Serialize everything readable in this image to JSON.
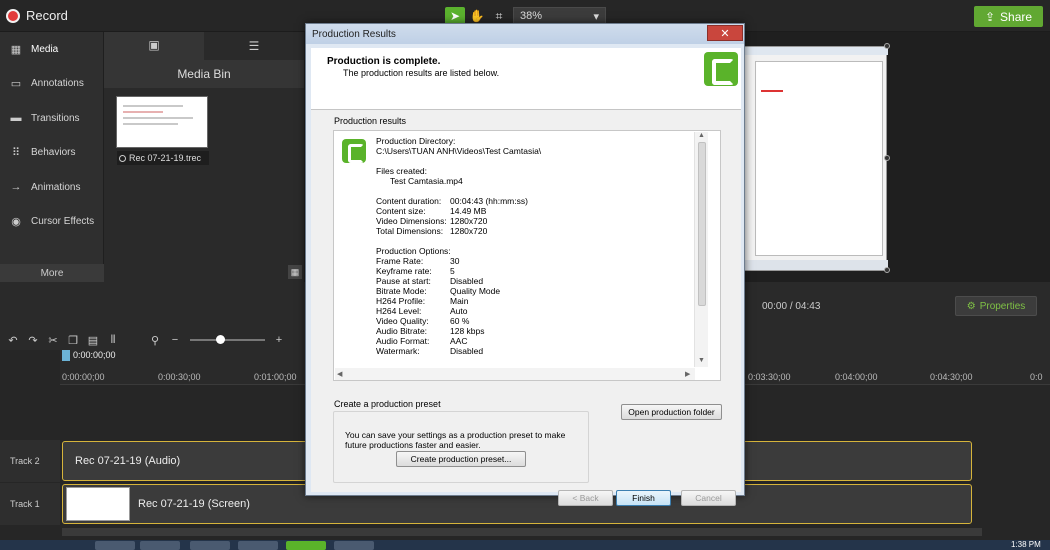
{
  "topbar": {
    "record_label": "Record",
    "zoom_value": "38%",
    "share_label": "Share",
    "colors": {
      "share": "#61a832",
      "record_dot": "#e23b3b"
    }
  },
  "sidebar": {
    "items": [
      {
        "label": "Media",
        "icon": "film-icon"
      },
      {
        "label": "Annotations",
        "icon": "annotation-icon"
      },
      {
        "label": "Transitions",
        "icon": "transition-icon"
      },
      {
        "label": "Behaviors",
        "icon": "behavior-icon"
      },
      {
        "label": "Animations",
        "icon": "animation-icon"
      },
      {
        "label": "Cursor Effects",
        "icon": "cursor-icon"
      }
    ],
    "more_label": "More",
    "add_label": "+"
  },
  "media_bin": {
    "title": "Media Bin",
    "clip_label": "Rec 07-21-19.trec"
  },
  "playback": {
    "current_time": "00:00",
    "separator": "/",
    "total_time": "04:43",
    "properties_label": "Properties"
  },
  "timeline": {
    "playhead_time": "0:00:00;00",
    "ticks": [
      "0:00:00;00",
      "0:00:30;00",
      "0:01:00;00",
      "0:03:30;00",
      "0:04:00;00",
      "0:04:30;00",
      "0:0"
    ],
    "tracks": [
      {
        "label": "Track 2",
        "clip": "Rec 07-21-19 (Audio)"
      },
      {
        "label": "Track 1",
        "clip": "Rec 07-21-19 (Screen)"
      }
    ]
  },
  "dialog": {
    "title": "Production Results",
    "close": "✕",
    "heading": "Production is complete.",
    "subheading": "The production results are listed below.",
    "results_label": "Production results",
    "directory_label": "Production Directory:",
    "directory_value": "C:\\Users\\TUAN ANH\\Videos\\Test Camtasia\\",
    "files_label": "Files created:",
    "file_name": "Test Camtasia.mp4",
    "stats": [
      {
        "key": "Content duration:",
        "value": "00:04:43 (hh:mm:ss)"
      },
      {
        "key": "Content size:",
        "value": "14.49 MB"
      },
      {
        "key": "Video Dimensions:",
        "value": "1280x720"
      },
      {
        "key": "Total Dimensions:",
        "value": "1280x720"
      }
    ],
    "options_label": "Production Options:",
    "options": [
      {
        "key": "Frame Rate:",
        "value": "30"
      },
      {
        "key": "Keyframe rate:",
        "value": "5"
      },
      {
        "key": "Pause at start:",
        "value": "Disabled"
      },
      {
        "key": "Bitrate Mode:",
        "value": "Quality Mode"
      },
      {
        "key": "H264 Profile:",
        "value": "Main"
      },
      {
        "key": "H264 Level:",
        "value": "Auto"
      },
      {
        "key": "Video Quality:",
        "value": "60 %"
      },
      {
        "key": "Audio Bitrate:",
        "value": "128 kbps"
      },
      {
        "key": "Audio Format:",
        "value": "AAC"
      },
      {
        "key": "Watermark:",
        "value": "Disabled"
      }
    ],
    "preset_group_label": "Create a production preset",
    "preset_text": "You can save your settings as a production preset to make future productions faster and easier.",
    "create_preset_button": "Create production preset...",
    "open_folder_button": "Open production folder",
    "back_button": "< Back",
    "finish_button": "Finish",
    "cancel_button": "Cancel"
  },
  "taskbar": {
    "clock": "1:38 PM"
  }
}
